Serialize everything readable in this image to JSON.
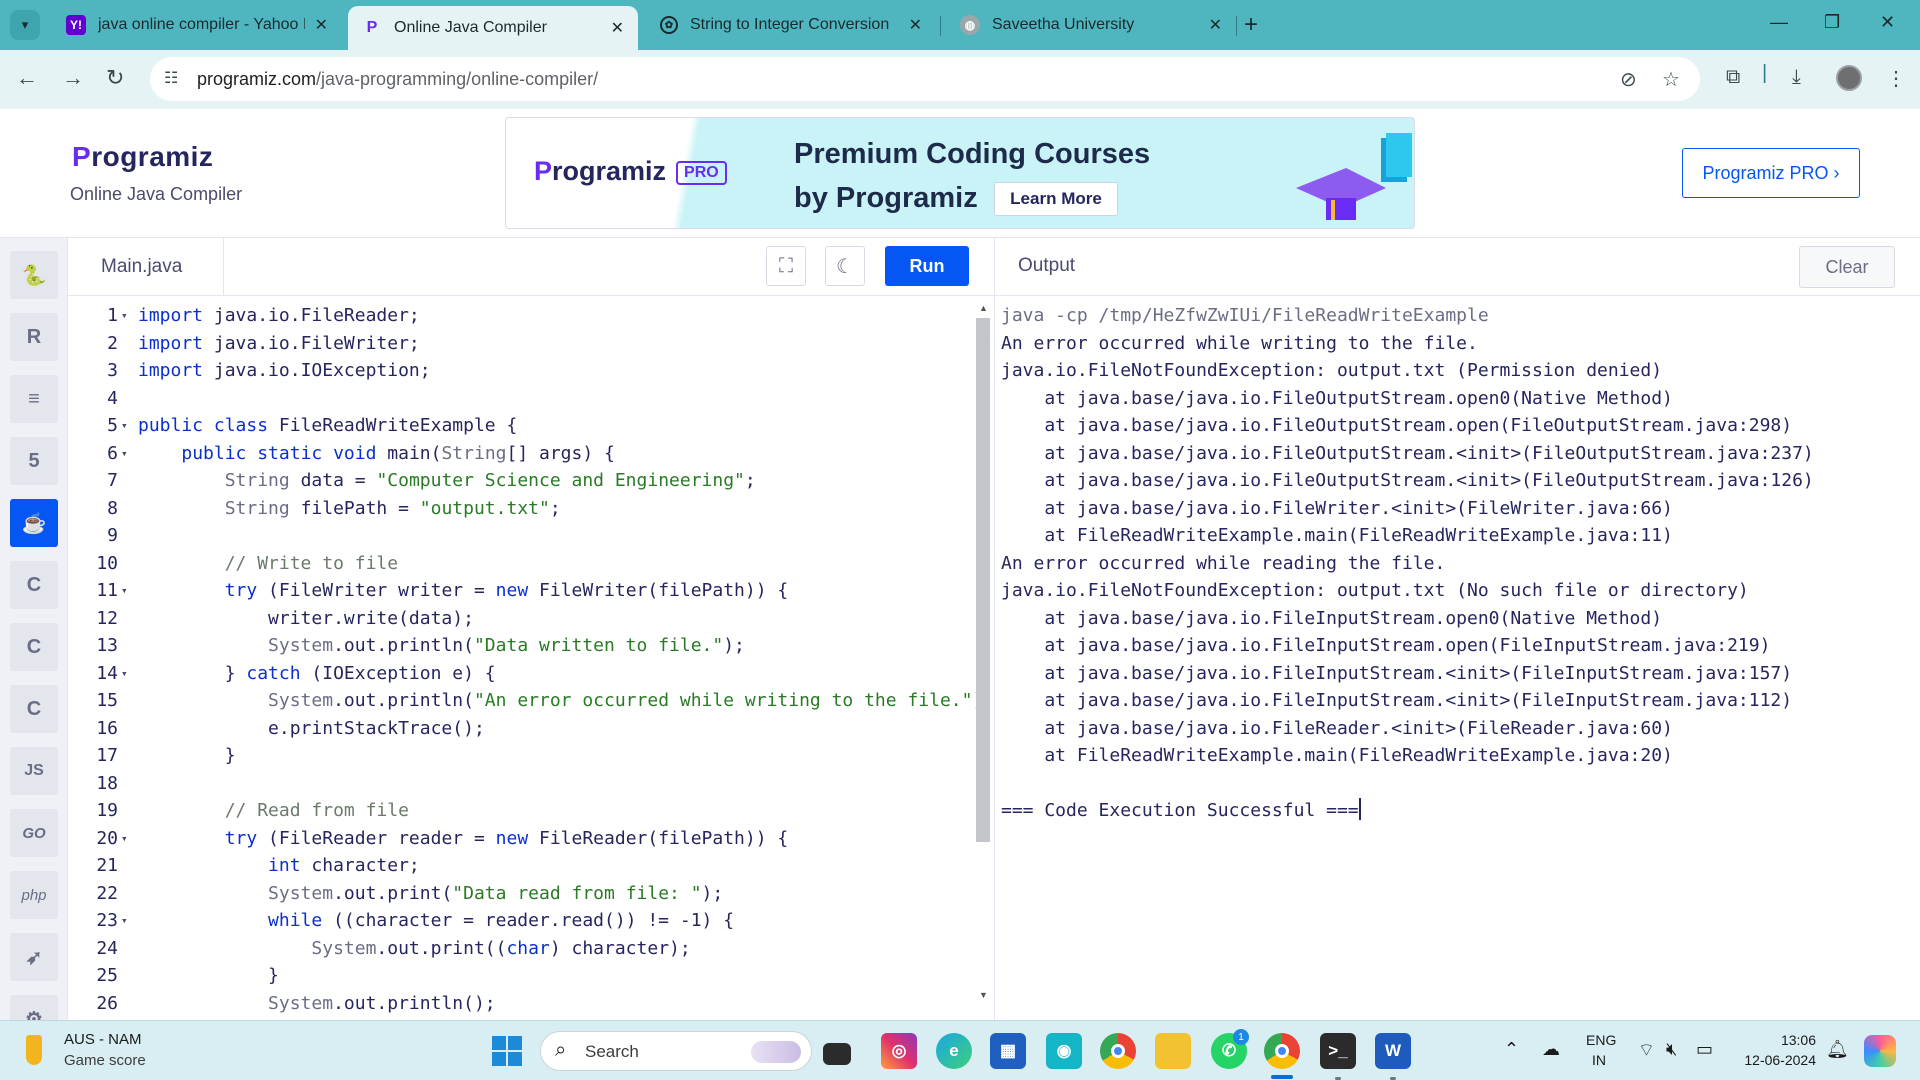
{
  "browser": {
    "tabs": [
      {
        "title": "java online compiler - Yahoo In",
        "favicon": "yahoo-icon"
      },
      {
        "title": "Online Java Compiler",
        "favicon": "programiz-icon"
      },
      {
        "title": "String to Integer Conversion",
        "favicon": "openai-icon"
      },
      {
        "title": "Saveetha University",
        "favicon": "globe-icon"
      }
    ],
    "active_tab": 1,
    "url_host": "programiz.com",
    "url_path": "/java-programming/online-compiler/"
  },
  "header": {
    "logo_text": "rogramiz",
    "logo_p": "P",
    "subtitle": "Online Java Compiler",
    "banner": {
      "logo_p": "P",
      "logo_text": "rogramiz",
      "badge": "PRO",
      "title_line1": "Premium Coding Courses",
      "title_line2": "by Programiz",
      "cta": "Learn More"
    },
    "pro_button": "Programiz PRO ›"
  },
  "sidebar": {
    "languages": [
      {
        "name": "python",
        "glyph": "🐍"
      },
      {
        "name": "r",
        "glyph": "R"
      },
      {
        "name": "sql",
        "glyph": "≡"
      },
      {
        "name": "html",
        "glyph": "5"
      },
      {
        "name": "java",
        "glyph": "☕"
      },
      {
        "name": "c",
        "glyph": "C"
      },
      {
        "name": "cpp",
        "glyph": "C"
      },
      {
        "name": "csharp",
        "glyph": "C"
      },
      {
        "name": "js",
        "glyph": "JS"
      },
      {
        "name": "go",
        "glyph": "GO"
      },
      {
        "name": "php",
        "glyph": "php"
      },
      {
        "name": "swift",
        "glyph": "➶"
      },
      {
        "name": "rust",
        "glyph": "⚙"
      }
    ],
    "active": "java"
  },
  "editor": {
    "file_tab": "Main.java",
    "run_label": "Run",
    "lines": [
      {
        "n": "1",
        "fold": true,
        "tokens": [
          [
            "kw",
            "import"
          ],
          [
            "",
            "java.io.FileReader;"
          ]
        ]
      },
      {
        "n": "2",
        "fold": false,
        "tokens": [
          [
            "kw",
            "import"
          ],
          [
            "",
            "java.io.FileWriter;"
          ]
        ]
      },
      {
        "n": "3",
        "fold": false,
        "tokens": [
          [
            "kw",
            "import"
          ],
          [
            "",
            "java.io.IOException;"
          ]
        ]
      },
      {
        "n": "4",
        "fold": false,
        "tokens": []
      },
      {
        "n": "5",
        "fold": true,
        "tokens": [
          [
            "kw",
            "public class"
          ],
          [
            "",
            "FileReadWriteExample {"
          ]
        ]
      },
      {
        "n": "6",
        "fold": true,
        "tokens": [
          [
            "",
            "    "
          ],
          [
            "kw",
            "public static void"
          ],
          [
            "",
            " main("
          ],
          [
            "ty",
            "String"
          ],
          [
            "",
            "[] args) {"
          ]
        ]
      },
      {
        "n": "7",
        "fold": false,
        "tokens": [
          [
            "",
            "        "
          ],
          [
            "ty",
            "String"
          ],
          [
            "",
            " data = "
          ],
          [
            "str",
            "\"Computer Science and Engineering\""
          ],
          [
            "",
            ";"
          ]
        ]
      },
      {
        "n": "8",
        "fold": false,
        "tokens": [
          [
            "",
            "        "
          ],
          [
            "ty",
            "String"
          ],
          [
            "",
            " filePath = "
          ],
          [
            "str",
            "\"output.txt\""
          ],
          [
            "",
            ";"
          ]
        ]
      },
      {
        "n": "9",
        "fold": false,
        "tokens": []
      },
      {
        "n": "10",
        "fold": false,
        "tokens": [
          [
            "",
            "        "
          ],
          [
            "cm",
            "// Write to file"
          ]
        ]
      },
      {
        "n": "11",
        "fold": true,
        "tokens": [
          [
            "",
            "        "
          ],
          [
            "kw",
            "try"
          ],
          [
            "",
            " (FileWriter writer = "
          ],
          [
            "kw",
            "new"
          ],
          [
            "",
            " FileWriter(filePath)) {"
          ]
        ]
      },
      {
        "n": "12",
        "fold": false,
        "tokens": [
          [
            "",
            "            writer.write(data);"
          ]
        ]
      },
      {
        "n": "13",
        "fold": false,
        "tokens": [
          [
            "",
            "            "
          ],
          [
            "ty",
            "System"
          ],
          [
            "",
            ".out.println("
          ],
          [
            "str",
            "\"Data written to file.\""
          ],
          [
            "",
            ");"
          ]
        ]
      },
      {
        "n": "14",
        "fold": true,
        "tokens": [
          [
            "",
            "        } "
          ],
          [
            "kw",
            "catch"
          ],
          [
            "",
            " (IOException e) {"
          ]
        ]
      },
      {
        "n": "15",
        "fold": false,
        "tokens": [
          [
            "",
            "            "
          ],
          [
            "ty",
            "System"
          ],
          [
            "",
            ".out.println("
          ],
          [
            "str",
            "\"An error occurred while writing to the file.\""
          ],
          [
            "",
            ");"
          ]
        ]
      },
      {
        "n": "16",
        "fold": false,
        "tokens": [
          [
            "",
            "            e.printStackTrace();"
          ]
        ]
      },
      {
        "n": "17",
        "fold": false,
        "tokens": [
          [
            "",
            "        }"
          ]
        ]
      },
      {
        "n": "18",
        "fold": false,
        "tokens": []
      },
      {
        "n": "19",
        "fold": false,
        "tokens": [
          [
            "",
            "        "
          ],
          [
            "cm",
            "// Read from file"
          ]
        ]
      },
      {
        "n": "20",
        "fold": true,
        "tokens": [
          [
            "",
            "        "
          ],
          [
            "kw",
            "try"
          ],
          [
            "",
            " (FileReader reader = "
          ],
          [
            "kw",
            "new"
          ],
          [
            "",
            " FileReader(filePath)) {"
          ]
        ]
      },
      {
        "n": "21",
        "fold": false,
        "tokens": [
          [
            "",
            "            "
          ],
          [
            "kw",
            "int"
          ],
          [
            "",
            " character;"
          ]
        ]
      },
      {
        "n": "22",
        "fold": false,
        "tokens": [
          [
            "",
            "            "
          ],
          [
            "ty",
            "System"
          ],
          [
            "",
            ".out.print("
          ],
          [
            "str",
            "\"Data read from file: \""
          ],
          [
            "",
            ");"
          ]
        ]
      },
      {
        "n": "23",
        "fold": true,
        "tokens": [
          [
            "",
            "            "
          ],
          [
            "kw",
            "while"
          ],
          [
            "",
            " ((character = reader.read()) != -1) {"
          ]
        ]
      },
      {
        "n": "24",
        "fold": false,
        "tokens": [
          [
            "",
            "                "
          ],
          [
            "ty",
            "System"
          ],
          [
            "",
            ".out.print(("
          ],
          [
            "kw",
            "char"
          ],
          [
            "",
            ") character);"
          ]
        ]
      },
      {
        "n": "25",
        "fold": false,
        "tokens": [
          [
            "",
            "            }"
          ]
        ]
      },
      {
        "n": "26",
        "fold": false,
        "tokens": [
          [
            "",
            "            "
          ],
          [
            "ty",
            "System"
          ],
          [
            "",
            ".out.println();"
          ]
        ]
      }
    ]
  },
  "output": {
    "title": "Output",
    "clear_label": "Clear",
    "lines": [
      {
        "text": "java -cp /tmp/HeZfwZwIUi/FileReadWriteExample",
        "cmd": true
      },
      {
        "text": "An error occurred while writing to the file.",
        "cmd": false
      },
      {
        "text": "java.io.FileNotFoundException: output.txt (Permission denied)",
        "cmd": false
      },
      {
        "text": "    at java.base/java.io.FileOutputStream.open0(Native Method)",
        "cmd": false
      },
      {
        "text": "    at java.base/java.io.FileOutputStream.open(FileOutputStream.java:298)",
        "cmd": false
      },
      {
        "text": "    at java.base/java.io.FileOutputStream.<init>(FileOutputStream.java:237)",
        "cmd": false
      },
      {
        "text": "    at java.base/java.io.FileOutputStream.<init>(FileOutputStream.java:126)",
        "cmd": false
      },
      {
        "text": "    at java.base/java.io.FileWriter.<init>(FileWriter.java:66)",
        "cmd": false
      },
      {
        "text": "    at FileReadWriteExample.main(FileReadWriteExample.java:11)",
        "cmd": false
      },
      {
        "text": "An error occurred while reading the file.",
        "cmd": false
      },
      {
        "text": "java.io.FileNotFoundException: output.txt (No such file or directory)",
        "cmd": false
      },
      {
        "text": "    at java.base/java.io.FileInputStream.open0(Native Method)",
        "cmd": false
      },
      {
        "text": "    at java.base/java.io.FileInputStream.open(FileInputStream.java:219)",
        "cmd": false
      },
      {
        "text": "    at java.base/java.io.FileInputStream.<init>(FileInputStream.java:157)",
        "cmd": false
      },
      {
        "text": "    at java.base/java.io.FileInputStream.<init>(FileInputStream.java:112)",
        "cmd": false
      },
      {
        "text": "    at java.base/java.io.FileReader.<init>(FileReader.java:60)",
        "cmd": false
      },
      {
        "text": "    at FileReadWriteExample.main(FileReadWriteExample.java:20)",
        "cmd": false
      },
      {
        "text": "",
        "cmd": false
      },
      {
        "text": "=== Code Execution Successful ===",
        "cmd": false,
        "cursor": true
      }
    ]
  },
  "taskbar": {
    "weather_line1": "AUS - NAM",
    "weather_line2": "Game score",
    "search_label": "Search",
    "apps": [
      "file-explorer-icon",
      "instagram-icon",
      "edge-icon",
      "store-icon",
      "app-icon",
      "chrome-icon",
      "folder-icon",
      "whatsapp-icon",
      "chrome-profile-icon",
      "terminal-icon",
      "word-icon"
    ],
    "whatsapp_badge": "1",
    "lang_line1": "ENG",
    "lang_line2": "IN",
    "time": "13:06",
    "date": "12-06-2024"
  },
  "colors": {
    "tabstrip": "#4fb6c0",
    "toolbar": "#e6f3f5",
    "accent": "#0556f3",
    "brand_purple": "#6a2cf5"
  }
}
